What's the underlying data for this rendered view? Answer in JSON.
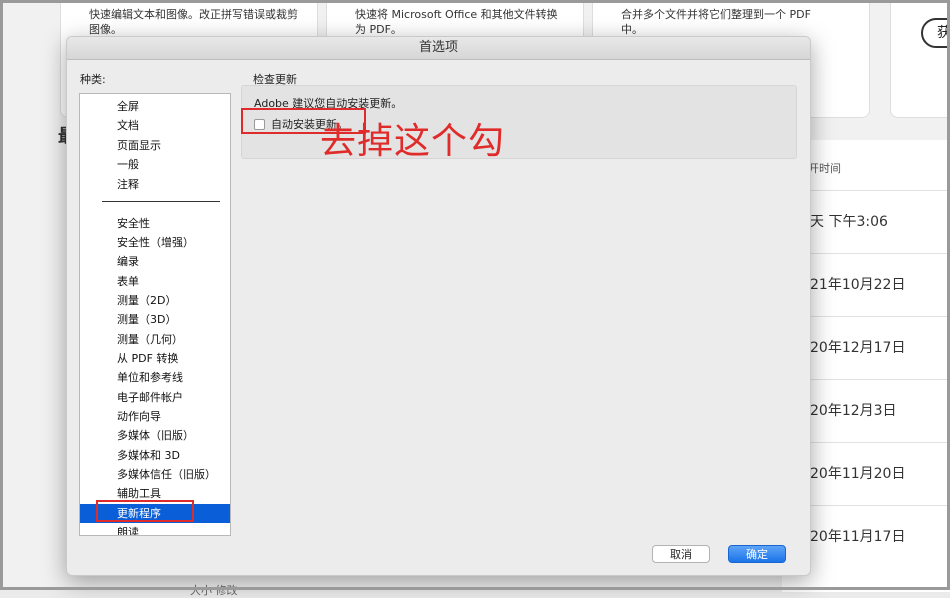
{
  "background": {
    "tool_cards": [
      {
        "desc": "快速编辑文本和图像。改正拼写错误或裁剪图像。"
      },
      {
        "desc": "快速将 Microsoft Office 和其他文件转换为 PDF。"
      },
      {
        "desc": "合并多个文件并将它们整理到一个 PDF 中。"
      }
    ],
    "top_button_label": "获",
    "section_heading": "最",
    "recent_header": "开时间",
    "recent_rows": [
      "天 下午3:06",
      "21年10月22日",
      "20年12月17日",
      "20年12月3日",
      "20年11月20日",
      "20年11月17日"
    ],
    "bottom_text": "大小 修改"
  },
  "dialog": {
    "title": "首选项",
    "category_label": "种类:",
    "categories_group1": [
      "全屏",
      "文档",
      "页面显示",
      "一般",
      "注释"
    ],
    "categories_group2": [
      "安全性",
      "安全性（增强）",
      "编录",
      "表单",
      "测量（2D）",
      "测量（3D）",
      "测量（几何）",
      "从 PDF 转换",
      "单位和参考线",
      "电子邮件帐户",
      "动作向导",
      "多媒体（旧版）",
      "多媒体和 3D",
      "多媒体信任（旧版）",
      "辅助工具",
      "更新程序",
      "朗读"
    ],
    "selected_category": "更新程序",
    "section_title": "检查更新",
    "section_message": "Adobe 建议您自动安装更新。",
    "auto_update_label": "自动安装更新。",
    "auto_update_checked": false,
    "cancel_label": "取消",
    "ok_label": "确定"
  },
  "annotation": {
    "text": "去掉这个勾",
    "color": "#e02b2b"
  },
  "colors": {
    "selection": "#0a5fd8",
    "ok_button": "#1b73e8"
  }
}
